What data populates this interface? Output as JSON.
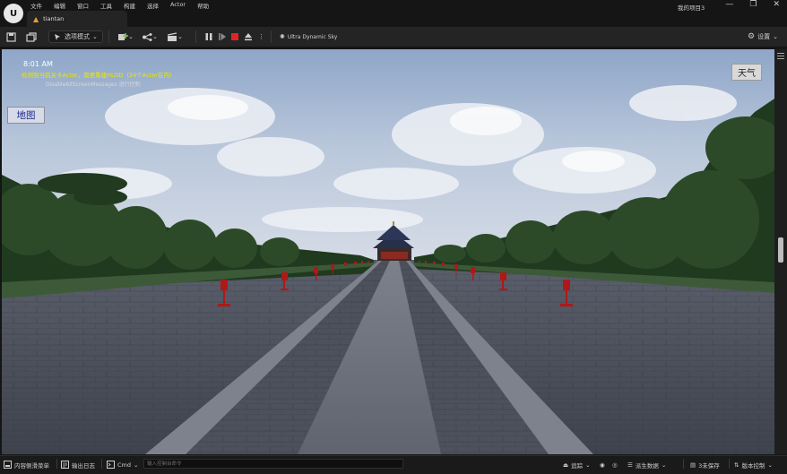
{
  "titlebar": {
    "logo": "U",
    "menu": [
      "文件",
      "编辑",
      "窗口",
      "工具",
      "构建",
      "选择",
      "Actor",
      "帮助"
    ],
    "tab_label": "tiantan",
    "project_name": "我的项目3",
    "window_controls": [
      "—",
      "❐",
      "✕"
    ]
  },
  "toolbar": {
    "mode_label": "选项模式",
    "sky_label": "Ultra Dynamic Sky",
    "settings_label": "设置"
  },
  "viewport": {
    "time": "8:01 AM",
    "message_1": "检测到当前关卡Actor，需要重建HLOD（24个Actor在内）",
    "message_2": "DisableAllScreenMessages  进行控制",
    "map_button": "地图",
    "weather_button": "天气"
  },
  "statusbar": {
    "content_drawer": "内容侧滑菜单",
    "output_log": "输出日志",
    "cmd_label": "Cmd",
    "cmd_placeholder": "输入控制台命令",
    "trace": "追踪",
    "derived_data": "派生数据",
    "unsaved": "3未保存",
    "source_control": "版本控制"
  },
  "colors": {
    "stop_red": "#e02424",
    "overlay_yellow": "#e8e800",
    "map_text": "#1f2a8a"
  }
}
